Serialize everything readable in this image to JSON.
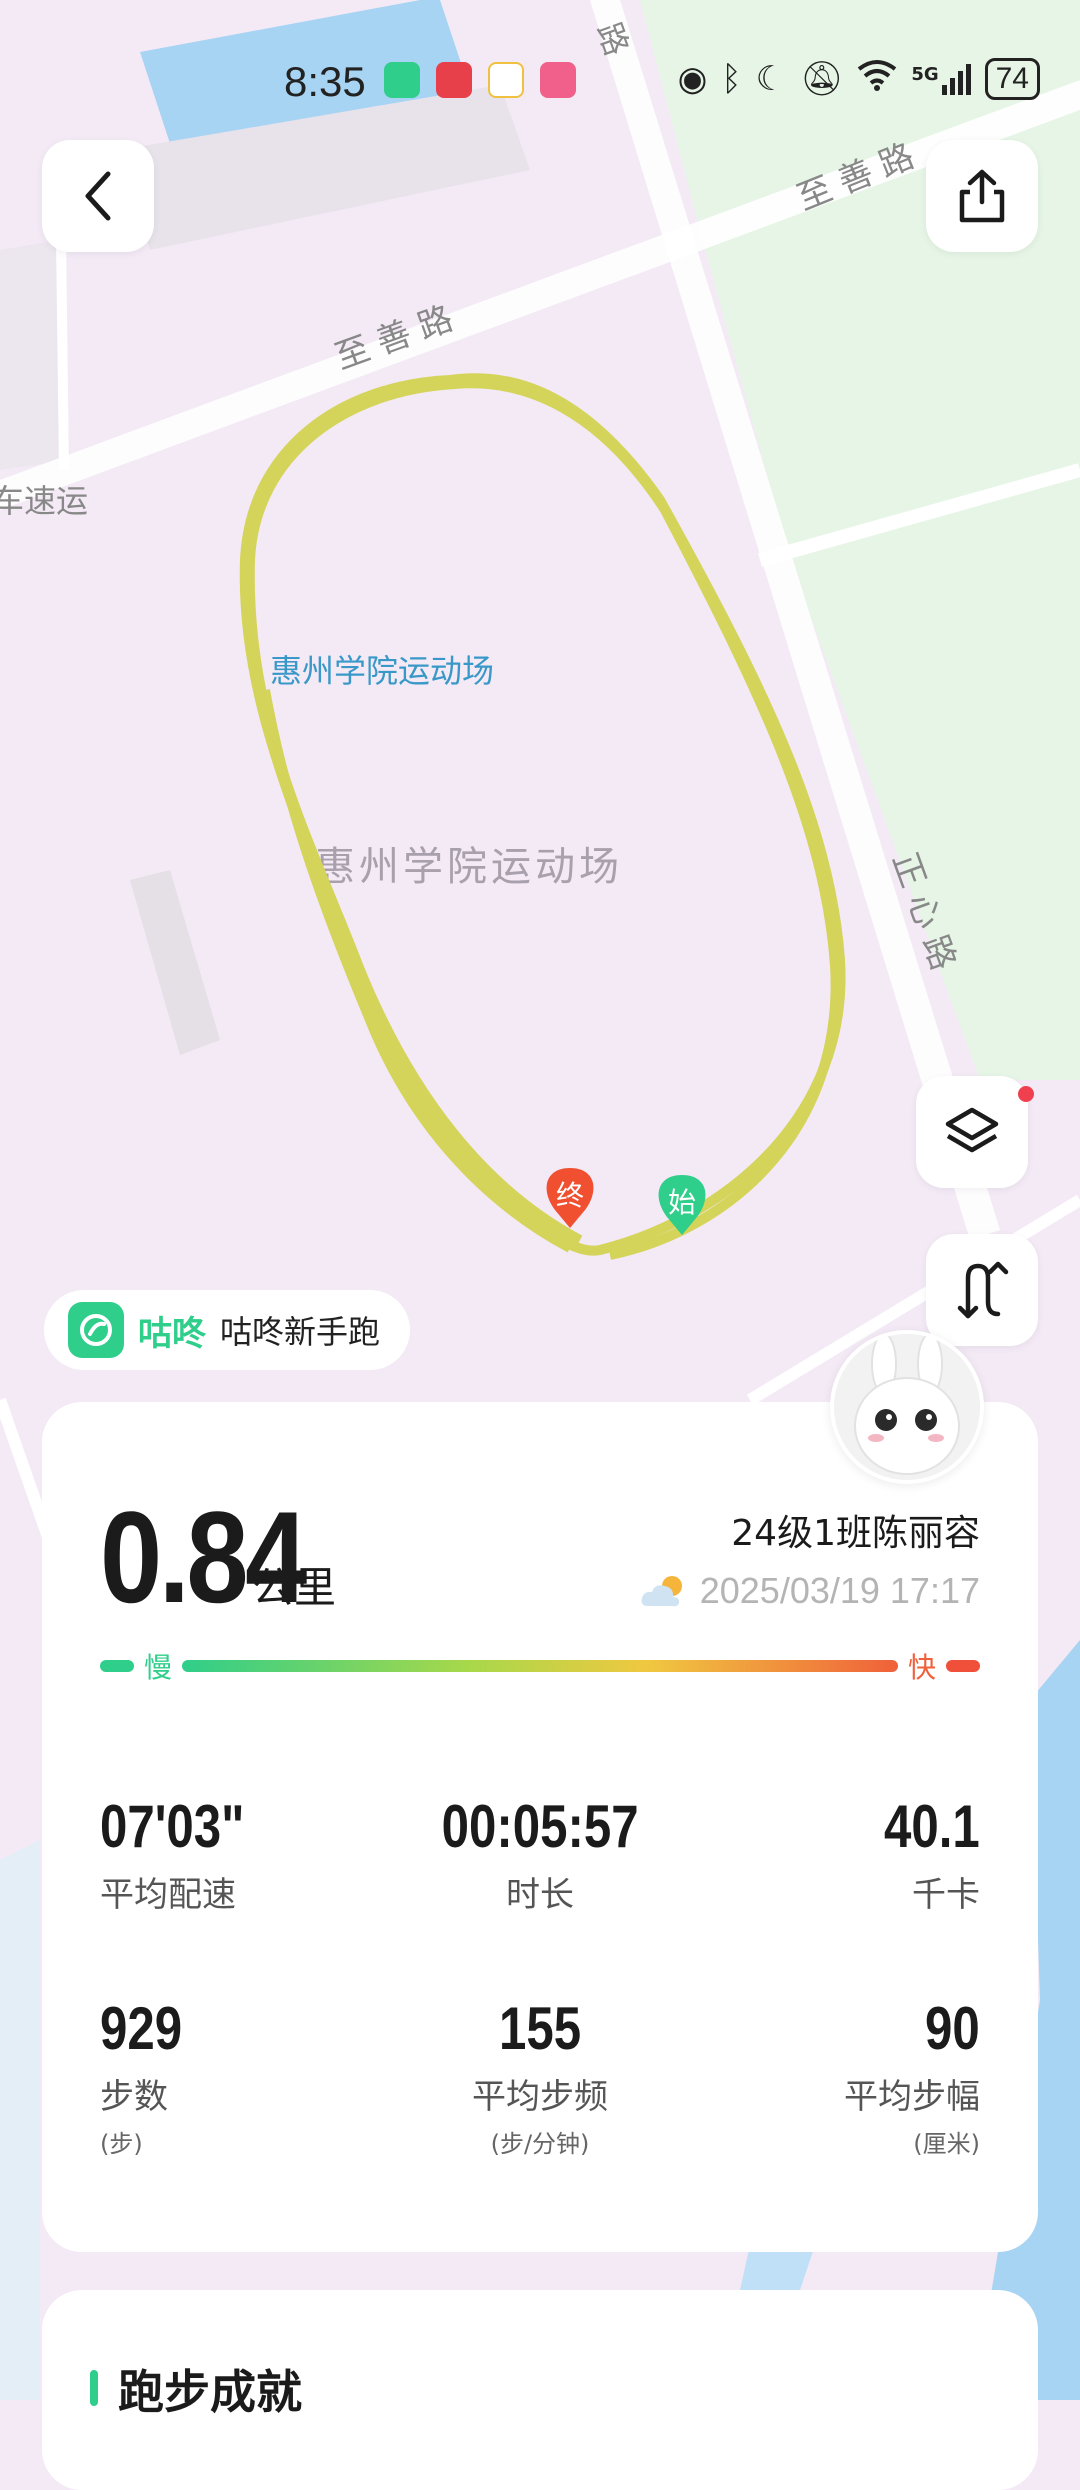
{
  "status_bar": {
    "time": "8:35",
    "battery": "74",
    "icons": [
      "eye-icon",
      "bluetooth-icon",
      "moon-icon",
      "mute-bell-icon",
      "wifi-icon",
      "cellular-5g-icon"
    ],
    "network": "5G"
  },
  "map": {
    "road_labels": [
      "至善路",
      "至善路",
      "正心路",
      "路"
    ],
    "partial_label": "车速运",
    "venue_label_blue": "惠州学院运动场",
    "venue_label_gray": "惠州学院运动场",
    "start_marker": "始",
    "end_marker": "终",
    "track_color": "#d4d45a"
  },
  "brand": {
    "name": "咕咚",
    "mode": "咕咚新手跑"
  },
  "summary": {
    "distance": "0.84",
    "unit": "公里",
    "user": "24级1班陈丽容",
    "datetime": "2025/03/19 17:17",
    "weather_icon": "partly-cloudy-icon"
  },
  "pace_scale": {
    "slow": "慢",
    "fast": "快"
  },
  "stats": {
    "pace": {
      "value": "07'03\"",
      "label": "平均配速"
    },
    "duration": {
      "value": "00:05:57",
      "label": "时长"
    },
    "calories": {
      "value": "40.1",
      "label": "千卡"
    },
    "steps": {
      "value": "929",
      "label": "步数",
      "unit": "(步)"
    },
    "cadence": {
      "value": "155",
      "label": "平均步频",
      "unit": "(步/分钟)"
    },
    "stride": {
      "value": "90",
      "label": "平均步幅",
      "unit": "(厘米)"
    }
  },
  "achievements": {
    "title": "跑步成就"
  },
  "colors": {
    "accent": "#2fce8a",
    "fast": "#f0603a",
    "map_bg": "#f3eaf6",
    "park": "#e4f4e4"
  }
}
